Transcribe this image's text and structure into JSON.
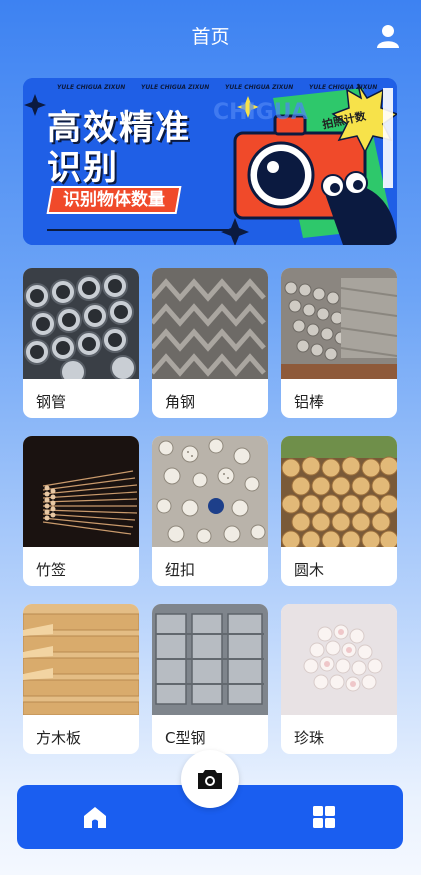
{
  "header": {
    "title": "首页",
    "user_icon": "user-icon"
  },
  "banner": {
    "line1": "高效精准",
    "line2": "识别",
    "tag": "识别物体数量",
    "badge": "拍照计数",
    "deco_text": "YULE CHIGUA ZIXUN",
    "watermark": "CHIGUA"
  },
  "items": [
    {
      "label": "钢管",
      "icon": "steel-pipe-image"
    },
    {
      "label": "角钢",
      "icon": "angle-steel-image"
    },
    {
      "label": "铝棒",
      "icon": "aluminum-rod-image"
    },
    {
      "label": "竹签",
      "icon": "bamboo-stick-image"
    },
    {
      "label": "纽扣",
      "icon": "button-image"
    },
    {
      "label": "圆木",
      "icon": "log-image"
    },
    {
      "label": "方木板",
      "icon": "wood-plank-image"
    },
    {
      "label": "C型钢",
      "icon": "c-steel-image"
    },
    {
      "label": "珍珠",
      "icon": "pearl-image"
    }
  ],
  "nav": {
    "home_icon": "home-icon",
    "apps_icon": "grid-icon",
    "camera_icon": "camera-icon"
  },
  "colors": {
    "primary": "#1a5ef0",
    "banner": "#1f5fe6",
    "tag": "#f04a2a"
  }
}
